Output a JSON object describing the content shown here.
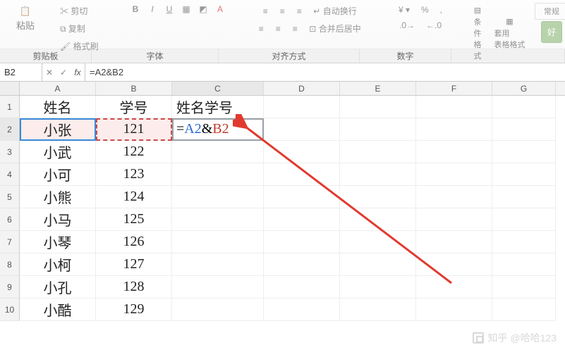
{
  "ribbon": {
    "clipboard": {
      "cut": "剪切",
      "copy": "复制",
      "paste": "粘贴",
      "format_painter": "格式刷",
      "label": "剪贴板"
    },
    "font": {
      "bold": "B",
      "italic": "I",
      "underline": "U",
      "label": "字体"
    },
    "alignment": {
      "wrap": "自动换行",
      "merge": "合并后居中",
      "label": "对齐方式"
    },
    "number": {
      "label": "数字"
    },
    "styles": {
      "cond": "条件格式",
      "table": "套用\n表格格式",
      "cell": "好",
      "normal": "常规"
    }
  },
  "namebox": "B2",
  "formula": "=A2&B2",
  "columns": [
    "A",
    "B",
    "C",
    "D",
    "E",
    "F",
    "G"
  ],
  "headerRow": {
    "A": "姓名",
    "B": "学号",
    "C": "姓名学号"
  },
  "editing_cell": {
    "eq": "=",
    "a": "A2",
    "amp": "&",
    "b": "B2"
  },
  "rows": [
    {
      "n": "1",
      "A": "姓名",
      "B": "学号",
      "C": "姓名学号"
    },
    {
      "n": "2",
      "A": "小张",
      "B": "121",
      "C_editing": true
    },
    {
      "n": "3",
      "A": "小武",
      "B": "122"
    },
    {
      "n": "4",
      "A": "小可",
      "B": "123"
    },
    {
      "n": "5",
      "A": "小熊",
      "B": "124"
    },
    {
      "n": "6",
      "A": "小马",
      "B": "125"
    },
    {
      "n": "7",
      "A": "小琴",
      "B": "126"
    },
    {
      "n": "8",
      "A": "小柯",
      "B": "127"
    },
    {
      "n": "9",
      "A": "小孔",
      "B": "128"
    },
    {
      "n": "10",
      "A": "小酷",
      "B": "129"
    }
  ],
  "watermark": "知乎 @哈哈123"
}
